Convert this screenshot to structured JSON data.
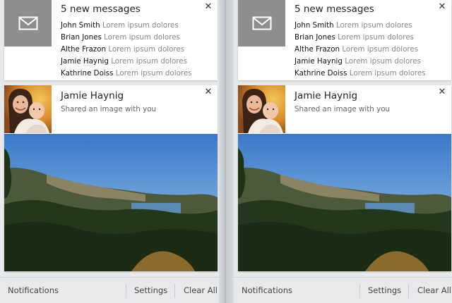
{
  "panels": [
    {
      "messages_card": {
        "title": "5 new messages",
        "icon": "mail-icon",
        "items": [
          {
            "sender": "John Smith",
            "preview": "Lorem ipsum dolores"
          },
          {
            "sender": "Brian Jones",
            "preview": "Lorem ipsum dolores"
          },
          {
            "sender": "Althe Frazon",
            "preview": "Lorem ipsum dolores"
          },
          {
            "sender": "Jamie Haynig",
            "preview": "Lorem ipsum dolores"
          },
          {
            "sender": "Kathrine Doiss",
            "preview": "Lorem ipsum dolores"
          }
        ],
        "close_glyph": "✕"
      },
      "share_card": {
        "name": "Jamie Haynig",
        "subtitle": "Shared an image with you",
        "close_glyph": "✕"
      },
      "footer": {
        "notifications_label": "Notifications",
        "settings_label": "Settings",
        "clear_all_label": "Clear All"
      }
    },
    {
      "messages_card": {
        "title": "5 new messages",
        "icon": "mail-icon",
        "items": [
          {
            "sender": "John Smith",
            "preview": "Lorem ipsum dolores"
          },
          {
            "sender": "Brian Jones",
            "preview": "Lorem ipsum dolores"
          },
          {
            "sender": "Althe Frazon",
            "preview": "Lorem ipsum dolores"
          },
          {
            "sender": "Jamie Haynig",
            "preview": "Lorem ipsum dolores"
          },
          {
            "sender": "Kathrine Doiss",
            "preview": "Lorem ipsum dolores"
          }
        ],
        "close_glyph": "✕"
      },
      "share_card": {
        "name": "Jamie Haynig",
        "subtitle": "Shared an image with you",
        "close_glyph": "✕"
      },
      "footer": {
        "notifications_label": "Notifications",
        "settings_label": "Settings",
        "clear_all_label": "Clear All"
      }
    }
  ],
  "colors": {
    "panel_bg": "#e8e9eb",
    "card_bg": "#ffffff",
    "mail_tile": "#8e8e8e",
    "sender_text": "#111111",
    "preview_text": "#888888",
    "sky_top": "#3a78c8",
    "sky_bottom": "#a9cde8"
  }
}
